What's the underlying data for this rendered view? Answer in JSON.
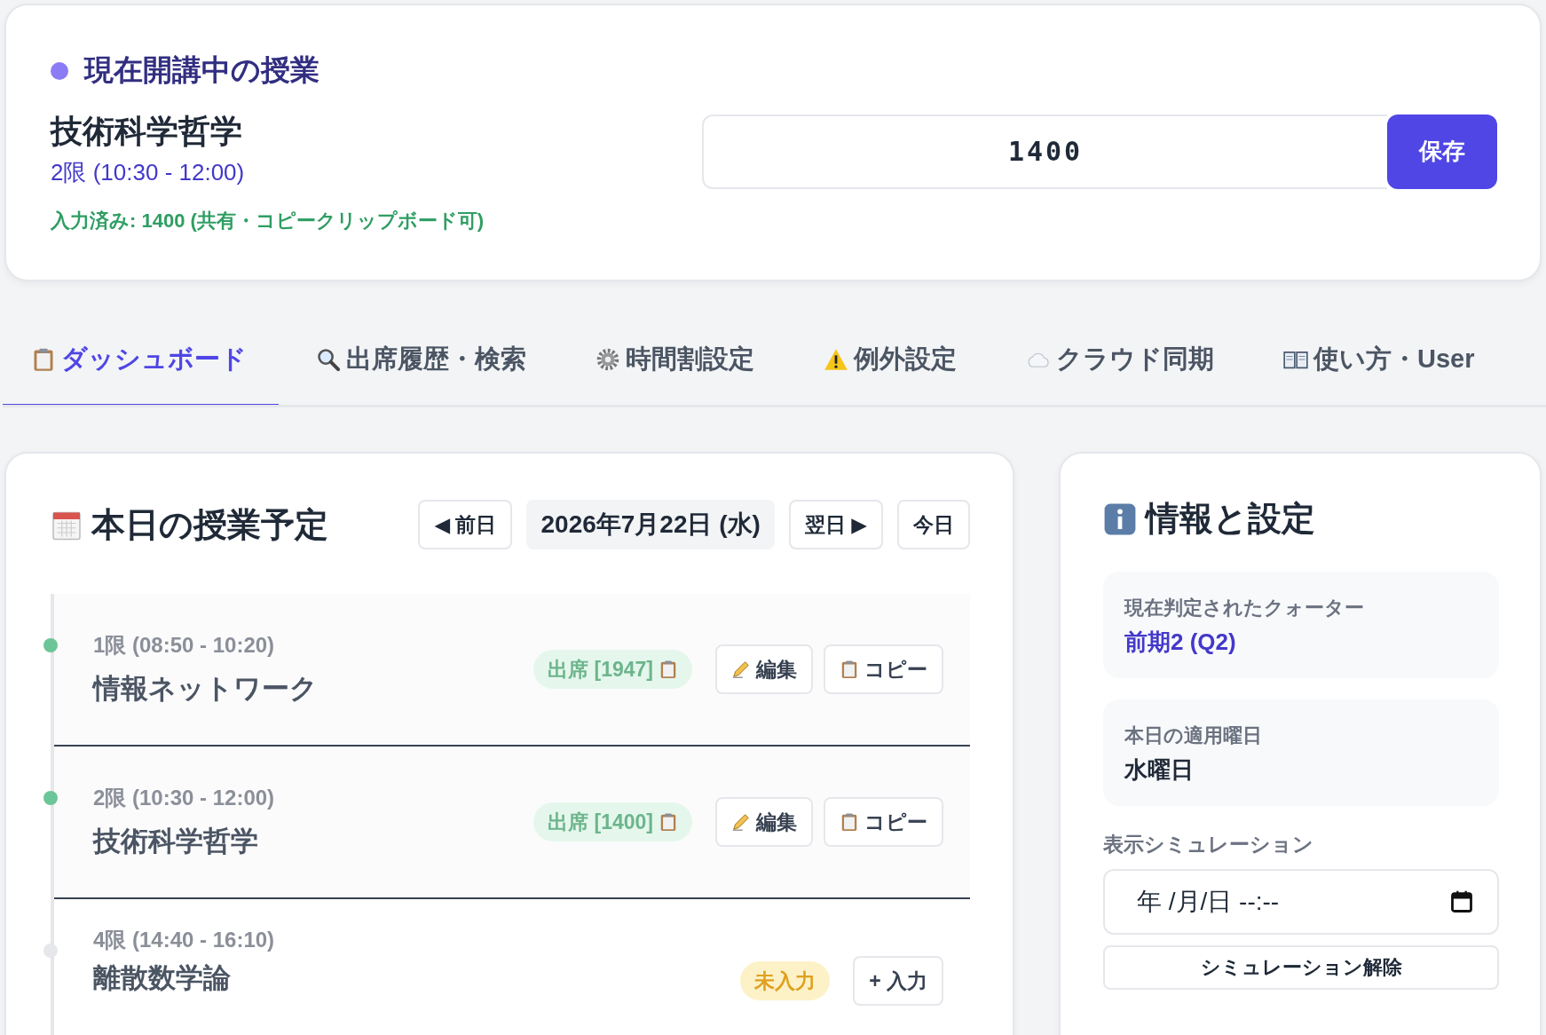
{
  "current_class": {
    "heading": "現在開講中の授業",
    "course": "技術科学哲学",
    "period": "2限 (10:30 - 12:00)",
    "note": "入力済み: 1400 (共有・コピークリップボード可)",
    "code_value": "1400",
    "save_button": "保存"
  },
  "tabs": [
    {
      "label": "ダッシュボード",
      "selected": true
    },
    {
      "label": "出席履歴・検索",
      "selected": false
    },
    {
      "label": "時間割設定",
      "selected": false
    },
    {
      "label": "例外設定",
      "selected": false
    },
    {
      "label": "クラウド同期",
      "selected": false
    },
    {
      "label": "使い方・User",
      "selected": false
    }
  ],
  "schedule": {
    "title": "本日の授業予定",
    "prev_button": "◀ 前日",
    "date": "2026年7月22日 (水)",
    "next_button": "翌日 ▶",
    "today_button": "今日",
    "classes": [
      {
        "kind": "attended",
        "period": "1限 (08:50 - 10:20)",
        "course": "情報ネットワーク",
        "status": "出席 [1947]",
        "actions": [
          "編集",
          "コピー"
        ]
      },
      {
        "kind": "attended",
        "period": "2限 (10:30 - 12:00)",
        "course": "技術科学哲学",
        "status": "出席 [1400]",
        "actions": [
          "編集",
          "コピー"
        ]
      },
      {
        "kind": "pending",
        "period": "4限 (14:40 - 16:10)",
        "course": "離散数学論",
        "status": "未入力",
        "actions": [
          "+ 入力"
        ]
      }
    ]
  },
  "info": {
    "title": "情報と設定",
    "items": [
      {
        "kind": "accent",
        "label": "現在判定されたクォーター",
        "value": "前期2 (Q2)"
      },
      {
        "kind": "plain",
        "label": "本日の適用曜日",
        "value": "水曜日"
      }
    ],
    "simulation_label": "表示シミュレーション",
    "simulation_placeholder": "年 /月/日 --:--",
    "clear_button": "シミュレーション解除"
  }
}
